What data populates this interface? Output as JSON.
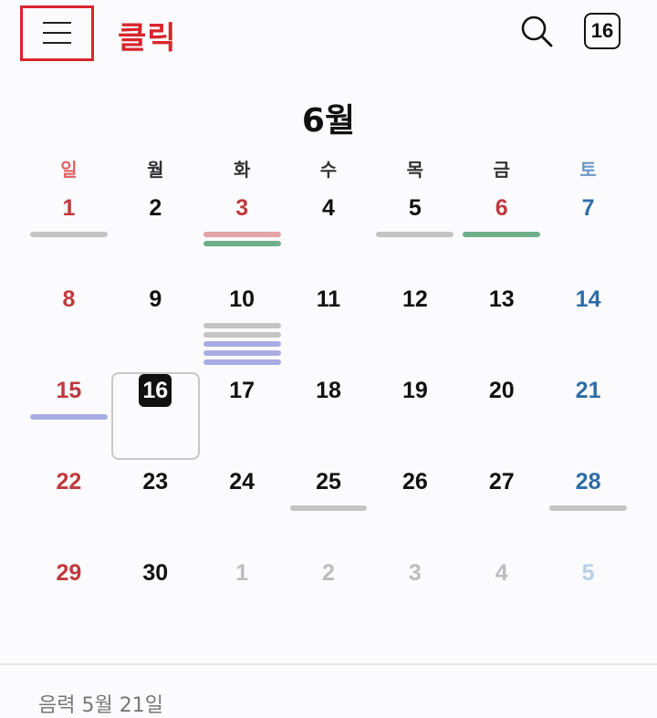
{
  "topbar": {
    "annotation": "클릭",
    "today_badge": "16"
  },
  "calendar": {
    "month_title": "6월",
    "weekdays": [
      "일",
      "월",
      "화",
      "수",
      "목",
      "금",
      "토"
    ],
    "weeks": [
      [
        {
          "day": "1",
          "kind": "sun",
          "events": [
            "#c4c4c4"
          ]
        },
        {
          "day": "2",
          "kind": "",
          "events": []
        },
        {
          "day": "3",
          "kind": "sun",
          "events": [
            "#e4a3a6",
            "#6fae8a"
          ]
        },
        {
          "day": "4",
          "kind": "",
          "events": []
        },
        {
          "day": "5",
          "kind": "",
          "events": [
            "#c4c4c4"
          ]
        },
        {
          "day": "6",
          "kind": "sun",
          "events": [
            "#6fae8a"
          ]
        },
        {
          "day": "7",
          "kind": "sat",
          "events": []
        }
      ],
      [
        {
          "day": "8",
          "kind": "sun",
          "events": []
        },
        {
          "day": "9",
          "kind": "",
          "events": []
        },
        {
          "day": "10",
          "kind": "",
          "events": [
            "#c4c4c4",
            "#c4c4c4",
            "#a9ace3",
            "#a9ace3",
            "#a9ace3"
          ]
        },
        {
          "day": "11",
          "kind": "",
          "events": []
        },
        {
          "day": "12",
          "kind": "",
          "events": []
        },
        {
          "day": "13",
          "kind": "",
          "events": []
        },
        {
          "day": "14",
          "kind": "sat",
          "events": []
        }
      ],
      [
        {
          "day": "15",
          "kind": "sun",
          "events": [
            "#a9ace3"
          ]
        },
        {
          "day": "16",
          "kind": "today",
          "events": []
        },
        {
          "day": "17",
          "kind": "",
          "events": []
        },
        {
          "day": "18",
          "kind": "",
          "events": []
        },
        {
          "day": "19",
          "kind": "",
          "events": []
        },
        {
          "day": "20",
          "kind": "",
          "events": []
        },
        {
          "day": "21",
          "kind": "sat",
          "events": []
        }
      ],
      [
        {
          "day": "22",
          "kind": "sun",
          "events": []
        },
        {
          "day": "23",
          "kind": "",
          "events": []
        },
        {
          "day": "24",
          "kind": "",
          "events": []
        },
        {
          "day": "25",
          "kind": "",
          "events": [
            "#c4c4c4"
          ]
        },
        {
          "day": "26",
          "kind": "",
          "events": []
        },
        {
          "day": "27",
          "kind": "",
          "events": []
        },
        {
          "day": "28",
          "kind": "sat",
          "events": [
            "#c4c4c4"
          ]
        }
      ],
      [
        {
          "day": "29",
          "kind": "sun",
          "events": []
        },
        {
          "day": "30",
          "kind": "",
          "events": []
        },
        {
          "day": "1",
          "kind": "other",
          "events": []
        },
        {
          "day": "2",
          "kind": "other",
          "events": []
        },
        {
          "day": "3",
          "kind": "other",
          "events": []
        },
        {
          "day": "4",
          "kind": "other",
          "events": []
        },
        {
          "day": "5",
          "kind": "other sat",
          "events": []
        }
      ]
    ]
  },
  "footer": {
    "lunar_date": "음력 5월 21일"
  },
  "colors": {
    "annotation_red": "#d9252c",
    "sunday_red": "#c0393d",
    "saturday_blue": "#2e6da8"
  }
}
